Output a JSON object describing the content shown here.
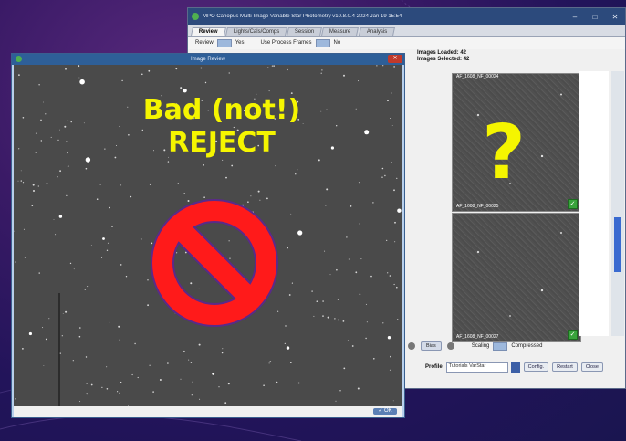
{
  "main_window": {
    "title": "MPO Canopus Multi-Image Variable Star Photometry  v10.8.0.4  2024 Jan 19  15:54",
    "controls": [
      "–",
      "□",
      "✕"
    ],
    "tabs": [
      {
        "label": "Review",
        "active": true
      },
      {
        "label": "Lights/Cals/Comps",
        "active": false
      },
      {
        "label": "Session",
        "active": false
      },
      {
        "label": "Measure",
        "active": false
      },
      {
        "label": "Analysis",
        "active": false
      }
    ],
    "options": {
      "review_label": "Review",
      "review_value": "Yes",
      "process_frames_label": "Use Process Frames",
      "process_frames_value": "No"
    },
    "images_loaded": "Images Loaded: 42",
    "images_selected": "Images Selected: 42",
    "thumbnails": [
      {
        "label": "AF_1608_NF_00024"
      },
      {
        "label": "AF_1608_NF_00025"
      },
      {
        "label": "AF_1608_NF_00026"
      },
      {
        "label": "AF_1608_NF_00027"
      }
    ],
    "bottom": {
      "bias_label": "Bias",
      "scaling_label": "Scaling",
      "scaling_value": "Compressed",
      "profile_label": "Profile",
      "profile_value": "Tutorials VarStar",
      "config_label": "Config.",
      "restart_label": "Restart",
      "close_label": "Close"
    }
  },
  "review_dialog": {
    "title": "Image Review",
    "close_symbol": "✕",
    "ok_label": "✓ OK"
  },
  "overlay": {
    "caption_line1": "Bad (not!)",
    "caption_line2": "REJECT",
    "question_mark": "?"
  },
  "colors": {
    "caption": "#f5f500",
    "no_sign": "#ff1a1a",
    "no_sign_outline": "#5a2a8a",
    "check": "#39a33c"
  }
}
